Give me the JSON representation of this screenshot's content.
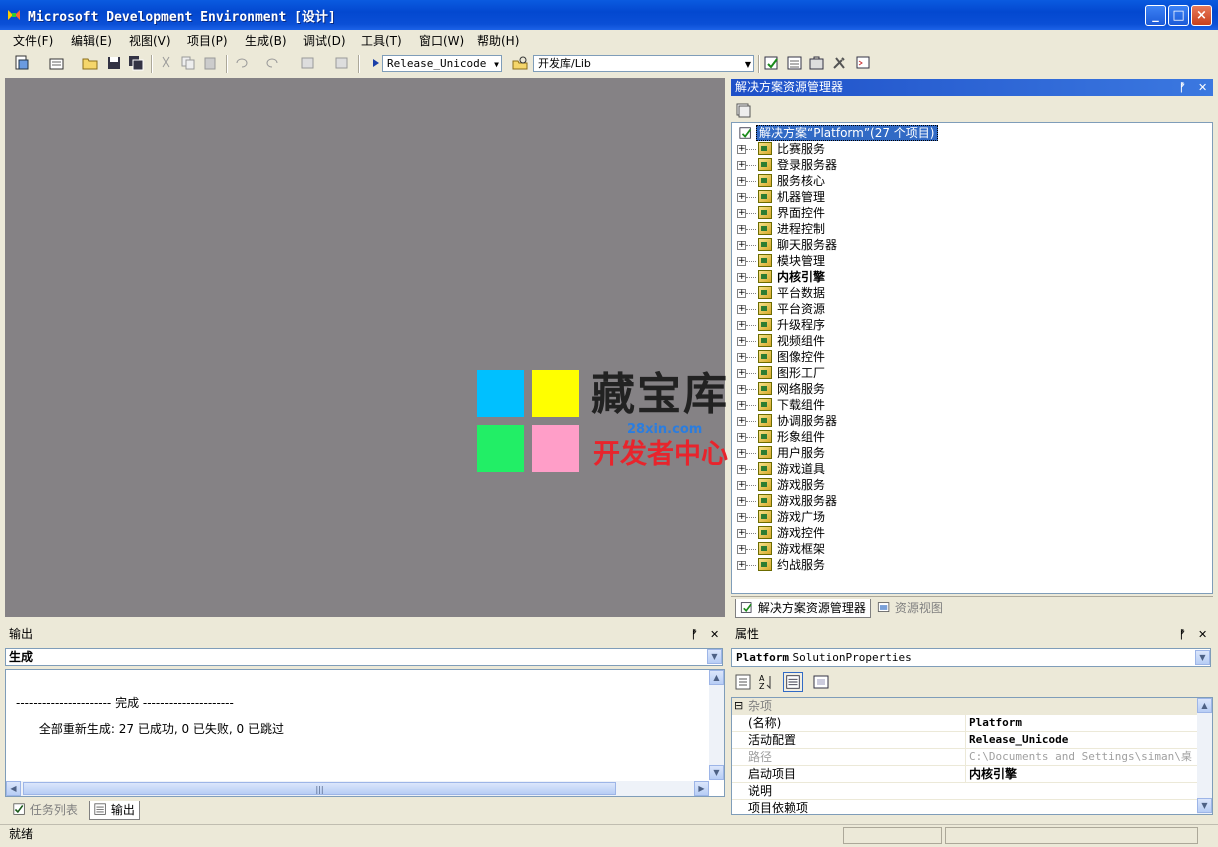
{
  "window": {
    "title": "Microsoft Development Environment [设计]"
  },
  "menu": [
    "文件(F)",
    "编辑(E)",
    "视图(V)",
    "项目(P)",
    "生成(B)",
    "调试(D)",
    "工具(T)",
    "窗口(W)",
    "帮助(H)"
  ],
  "toolbar": {
    "config": "Release_Unicode",
    "find_combo": "开发库/Lib"
  },
  "solution_explorer": {
    "title": "解决方案资源管理器",
    "root": "解决方案“Platform”(27 个项目)",
    "projects": [
      "比赛服务",
      "登录服务器",
      "服务核心",
      "机器管理",
      "界面控件",
      "进程控制",
      "聊天服务器",
      "模块管理",
      "内核引擎",
      "平台数据",
      "平台资源",
      "升级程序",
      "视频组件",
      "图像控件",
      "图形工厂",
      "网络服务",
      "下载组件",
      "协调服务器",
      "形象组件",
      "用户服务",
      "游戏道具",
      "游戏服务",
      "游戏服务器",
      "游戏广场",
      "游戏控件",
      "游戏框架",
      "约战服务"
    ],
    "startup_project": "内核引擎",
    "tabs": [
      "解决方案资源管理器",
      "资源视图"
    ]
  },
  "output": {
    "title": "输出",
    "source": "生成",
    "lines": [
      "---------------------- 完成 ---------------------",
      "      全部重新生成: 27 已成功, 0 已失败, 0 已跳过"
    ],
    "tabs": [
      "任务列表",
      "输出"
    ]
  },
  "properties": {
    "title": "属性",
    "object": "Platform",
    "object_type": "SolutionProperties",
    "category": "杂项",
    "rows": [
      {
        "key": "(名称)",
        "value": "Platform",
        "disabled": false
      },
      {
        "key": "活动配置",
        "value": "Release_Unicode",
        "disabled": false
      },
      {
        "key": "路径",
        "value": "C:\\Documents and Settings\\siman\\桌",
        "disabled": true
      },
      {
        "key": "启动项目",
        "value": "内核引擎",
        "disabled": false
      },
      {
        "key": "说明",
        "value": "",
        "disabled": false
      },
      {
        "key": "项目依赖项",
        "value": "",
        "disabled": false
      }
    ]
  },
  "status": {
    "text": "就绪"
  },
  "watermark": {
    "brand": "藏宝库",
    "url": "28xin.com",
    "slogan": "开发者中心",
    "colors": [
      "#00c0ff",
      "#ffff00",
      "#22ee66",
      "#ff9ec8"
    ]
  }
}
